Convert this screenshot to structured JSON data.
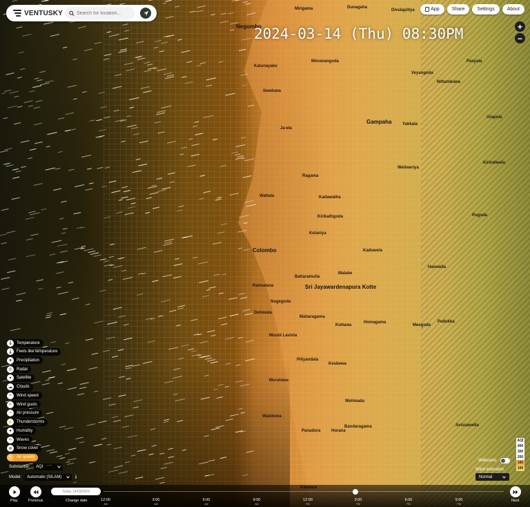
{
  "header": {
    "logo_text": "VENTUSKY",
    "search_placeholder": "Search for location...",
    "datetime": "2024-03-14 (Thu) 08:30PM"
  },
  "top_buttons": [
    "App",
    "Share",
    "Settings",
    "About"
  ],
  "zoom": {
    "in": "+",
    "out": "−"
  },
  "map_places": [
    {
      "name": "Negombo",
      "big": true
    },
    {
      "name": "Divulapitiya"
    },
    {
      "name": "Mirigama"
    },
    {
      "name": "Dunagaha"
    },
    {
      "name": "Colombo",
      "big": true
    },
    {
      "name": "Gampaha",
      "big": true
    },
    {
      "name": "Sri Jayawardenapura Kotte",
      "big": true
    },
    {
      "name": "Katunayake"
    },
    {
      "name": "Seeduwa"
    },
    {
      "name": "Ja-ela"
    },
    {
      "name": "Wattala"
    },
    {
      "name": "Kelaniya"
    },
    {
      "name": "Dehiwala"
    },
    {
      "name": "Mount Lavinia"
    },
    {
      "name": "Moratuwa"
    },
    {
      "name": "Panadura"
    },
    {
      "name": "Horana"
    },
    {
      "name": "Kaduwela"
    },
    {
      "name": "Malabe"
    },
    {
      "name": "Homagama"
    },
    {
      "name": "Kottawa"
    },
    {
      "name": "Maharagama"
    },
    {
      "name": "Nugegoda"
    },
    {
      "name": "Battaramulla"
    },
    {
      "name": "Kiribathgoda"
    },
    {
      "name": "Kadawatha"
    },
    {
      "name": "Ragama"
    },
    {
      "name": "Yakkala"
    },
    {
      "name": "Nittambuwa"
    },
    {
      "name": "Veyangoda"
    },
    {
      "name": "Minuwangoda"
    },
    {
      "name": "Hanwella"
    },
    {
      "name": "Padukka"
    },
    {
      "name": "Meegoda"
    },
    {
      "name": "Avissawella"
    },
    {
      "name": "Pugoda"
    },
    {
      "name": "Kirindiwela"
    },
    {
      "name": "Bandaragama"
    },
    {
      "name": "Piliyandala"
    },
    {
      "name": "Kesbewa"
    },
    {
      "name": "Ratmalana"
    },
    {
      "name": "Kalutara"
    },
    {
      "name": "Pasyala"
    },
    {
      "name": "Urapola"
    },
    {
      "name": "Welimada"
    },
    {
      "name": "Wadduwa"
    },
    {
      "name": "Weliweriya"
    }
  ],
  "layers": [
    {
      "label": "Temperature",
      "icon": "thermometer-icon"
    },
    {
      "label": "Feels like temperature",
      "icon": "thermometer-icon"
    },
    {
      "label": "Precipitation",
      "icon": "drop-icon"
    },
    {
      "label": "Radar",
      "icon": "radar-icon"
    },
    {
      "label": "Satellite",
      "icon": "satellite-icon"
    },
    {
      "label": "Clouds",
      "icon": "cloud-icon"
    },
    {
      "label": "Wind speed",
      "icon": "wind-icon"
    },
    {
      "label": "Wind gusts",
      "icon": "wind-icon"
    },
    {
      "label": "Air pressure",
      "icon": "gauge-icon"
    },
    {
      "label": "Thunderstorms",
      "icon": "lightning-icon"
    },
    {
      "label": "Humidity",
      "icon": "drop-icon"
    },
    {
      "label": "Waves",
      "icon": "wave-icon"
    },
    {
      "label": "Snow cover",
      "icon": "snowflake-icon"
    },
    {
      "label": "Air quality",
      "icon": "air-icon",
      "active": true
    }
  ],
  "substance": {
    "label": "Substance:",
    "value": "AQI"
  },
  "model": {
    "label": "Model:",
    "value": "Automatic (SILAM)",
    "info": "i"
  },
  "aqi_legend": {
    "title": "AQI",
    "steps": [
      {
        "value": "400",
        "color": "#ffffff"
      },
      {
        "value": "300",
        "color": "#ffffff"
      },
      {
        "value": "200",
        "color": "#ffffff"
      },
      {
        "value": "150",
        "color": "#f6b04a"
      },
      {
        "value": "100",
        "color": "#e9d36a"
      }
    ]
  },
  "webcams_label": "Webcams",
  "wind_animation": {
    "label": "Wind animation",
    "value": "Normal"
  },
  "timeline": {
    "play": "Play",
    "previous": "Previous",
    "change_date": "Change date",
    "date_value": "Today 14/03/2024",
    "next": "Next",
    "ticks": [
      {
        "time": "12:00",
        "sub": "AM"
      },
      {
        "time": "3:00",
        "sub": "AM"
      },
      {
        "time": "6:00",
        "sub": "AM"
      },
      {
        "time": "9:00",
        "sub": "AM"
      },
      {
        "time": "12:00",
        "sub": "PM"
      },
      {
        "time": "3:00",
        "sub": "PM"
      },
      {
        "time": "6:00",
        "sub": "PM"
      },
      {
        "time": "9:00",
        "sub": "PM"
      }
    ],
    "current_position": 0.63
  },
  "colors": {
    "accent": "#f0a021",
    "aqi_orange": "#dc9a3f"
  }
}
